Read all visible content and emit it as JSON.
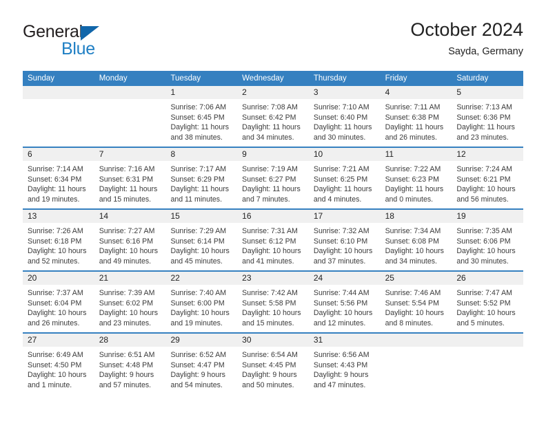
{
  "brand": {
    "word1": "General",
    "word2": "Blue",
    "accent_color": "#1f7fc4",
    "triangle_color": "#1166aa",
    "icon": "general-blue-logo"
  },
  "header": {
    "title": "October 2024",
    "subtitle": "Sayda, Germany"
  },
  "theme": {
    "header_blue": "#3580c0",
    "day_band_gray": "#f0f0f0",
    "text": "#222222"
  },
  "weekdays": [
    "Sunday",
    "Monday",
    "Tuesday",
    "Wednesday",
    "Thursday",
    "Friday",
    "Saturday"
  ],
  "weeks": [
    [
      {
        "day": "",
        "lines": []
      },
      {
        "day": "",
        "lines": []
      },
      {
        "day": "1",
        "lines": [
          "Sunrise: 7:06 AM",
          "Sunset: 6:45 PM",
          "Daylight: 11 hours",
          "and 38 minutes."
        ]
      },
      {
        "day": "2",
        "lines": [
          "Sunrise: 7:08 AM",
          "Sunset: 6:42 PM",
          "Daylight: 11 hours",
          "and 34 minutes."
        ]
      },
      {
        "day": "3",
        "lines": [
          "Sunrise: 7:10 AM",
          "Sunset: 6:40 PM",
          "Daylight: 11 hours",
          "and 30 minutes."
        ]
      },
      {
        "day": "4",
        "lines": [
          "Sunrise: 7:11 AM",
          "Sunset: 6:38 PM",
          "Daylight: 11 hours",
          "and 26 minutes."
        ]
      },
      {
        "day": "5",
        "lines": [
          "Sunrise: 7:13 AM",
          "Sunset: 6:36 PM",
          "Daylight: 11 hours",
          "and 23 minutes."
        ]
      }
    ],
    [
      {
        "day": "6",
        "lines": [
          "Sunrise: 7:14 AM",
          "Sunset: 6:34 PM",
          "Daylight: 11 hours",
          "and 19 minutes."
        ]
      },
      {
        "day": "7",
        "lines": [
          "Sunrise: 7:16 AM",
          "Sunset: 6:31 PM",
          "Daylight: 11 hours",
          "and 15 minutes."
        ]
      },
      {
        "day": "8",
        "lines": [
          "Sunrise: 7:17 AM",
          "Sunset: 6:29 PM",
          "Daylight: 11 hours",
          "and 11 minutes."
        ]
      },
      {
        "day": "9",
        "lines": [
          "Sunrise: 7:19 AM",
          "Sunset: 6:27 PM",
          "Daylight: 11 hours",
          "and 7 minutes."
        ]
      },
      {
        "day": "10",
        "lines": [
          "Sunrise: 7:21 AM",
          "Sunset: 6:25 PM",
          "Daylight: 11 hours",
          "and 4 minutes."
        ]
      },
      {
        "day": "11",
        "lines": [
          "Sunrise: 7:22 AM",
          "Sunset: 6:23 PM",
          "Daylight: 11 hours",
          "and 0 minutes."
        ]
      },
      {
        "day": "12",
        "lines": [
          "Sunrise: 7:24 AM",
          "Sunset: 6:21 PM",
          "Daylight: 10 hours",
          "and 56 minutes."
        ]
      }
    ],
    [
      {
        "day": "13",
        "lines": [
          "Sunrise: 7:26 AM",
          "Sunset: 6:18 PM",
          "Daylight: 10 hours",
          "and 52 minutes."
        ]
      },
      {
        "day": "14",
        "lines": [
          "Sunrise: 7:27 AM",
          "Sunset: 6:16 PM",
          "Daylight: 10 hours",
          "and 49 minutes."
        ]
      },
      {
        "day": "15",
        "lines": [
          "Sunrise: 7:29 AM",
          "Sunset: 6:14 PM",
          "Daylight: 10 hours",
          "and 45 minutes."
        ]
      },
      {
        "day": "16",
        "lines": [
          "Sunrise: 7:31 AM",
          "Sunset: 6:12 PM",
          "Daylight: 10 hours",
          "and 41 minutes."
        ]
      },
      {
        "day": "17",
        "lines": [
          "Sunrise: 7:32 AM",
          "Sunset: 6:10 PM",
          "Daylight: 10 hours",
          "and 37 minutes."
        ]
      },
      {
        "day": "18",
        "lines": [
          "Sunrise: 7:34 AM",
          "Sunset: 6:08 PM",
          "Daylight: 10 hours",
          "and 34 minutes."
        ]
      },
      {
        "day": "19",
        "lines": [
          "Sunrise: 7:35 AM",
          "Sunset: 6:06 PM",
          "Daylight: 10 hours",
          "and 30 minutes."
        ]
      }
    ],
    [
      {
        "day": "20",
        "lines": [
          "Sunrise: 7:37 AM",
          "Sunset: 6:04 PM",
          "Daylight: 10 hours",
          "and 26 minutes."
        ]
      },
      {
        "day": "21",
        "lines": [
          "Sunrise: 7:39 AM",
          "Sunset: 6:02 PM",
          "Daylight: 10 hours",
          "and 23 minutes."
        ]
      },
      {
        "day": "22",
        "lines": [
          "Sunrise: 7:40 AM",
          "Sunset: 6:00 PM",
          "Daylight: 10 hours",
          "and 19 minutes."
        ]
      },
      {
        "day": "23",
        "lines": [
          "Sunrise: 7:42 AM",
          "Sunset: 5:58 PM",
          "Daylight: 10 hours",
          "and 15 minutes."
        ]
      },
      {
        "day": "24",
        "lines": [
          "Sunrise: 7:44 AM",
          "Sunset: 5:56 PM",
          "Daylight: 10 hours",
          "and 12 minutes."
        ]
      },
      {
        "day": "25",
        "lines": [
          "Sunrise: 7:46 AM",
          "Sunset: 5:54 PM",
          "Daylight: 10 hours",
          "and 8 minutes."
        ]
      },
      {
        "day": "26",
        "lines": [
          "Sunrise: 7:47 AM",
          "Sunset: 5:52 PM",
          "Daylight: 10 hours",
          "and 5 minutes."
        ]
      }
    ],
    [
      {
        "day": "27",
        "lines": [
          "Sunrise: 6:49 AM",
          "Sunset: 4:50 PM",
          "Daylight: 10 hours",
          "and 1 minute."
        ]
      },
      {
        "day": "28",
        "lines": [
          "Sunrise: 6:51 AM",
          "Sunset: 4:48 PM",
          "Daylight: 9 hours",
          "and 57 minutes."
        ]
      },
      {
        "day": "29",
        "lines": [
          "Sunrise: 6:52 AM",
          "Sunset: 4:47 PM",
          "Daylight: 9 hours",
          "and 54 minutes."
        ]
      },
      {
        "day": "30",
        "lines": [
          "Sunrise: 6:54 AM",
          "Sunset: 4:45 PM",
          "Daylight: 9 hours",
          "and 50 minutes."
        ]
      },
      {
        "day": "31",
        "lines": [
          "Sunrise: 6:56 AM",
          "Sunset: 4:43 PM",
          "Daylight: 9 hours",
          "and 47 minutes."
        ]
      },
      {
        "day": "",
        "lines": []
      },
      {
        "day": "",
        "lines": []
      }
    ]
  ]
}
